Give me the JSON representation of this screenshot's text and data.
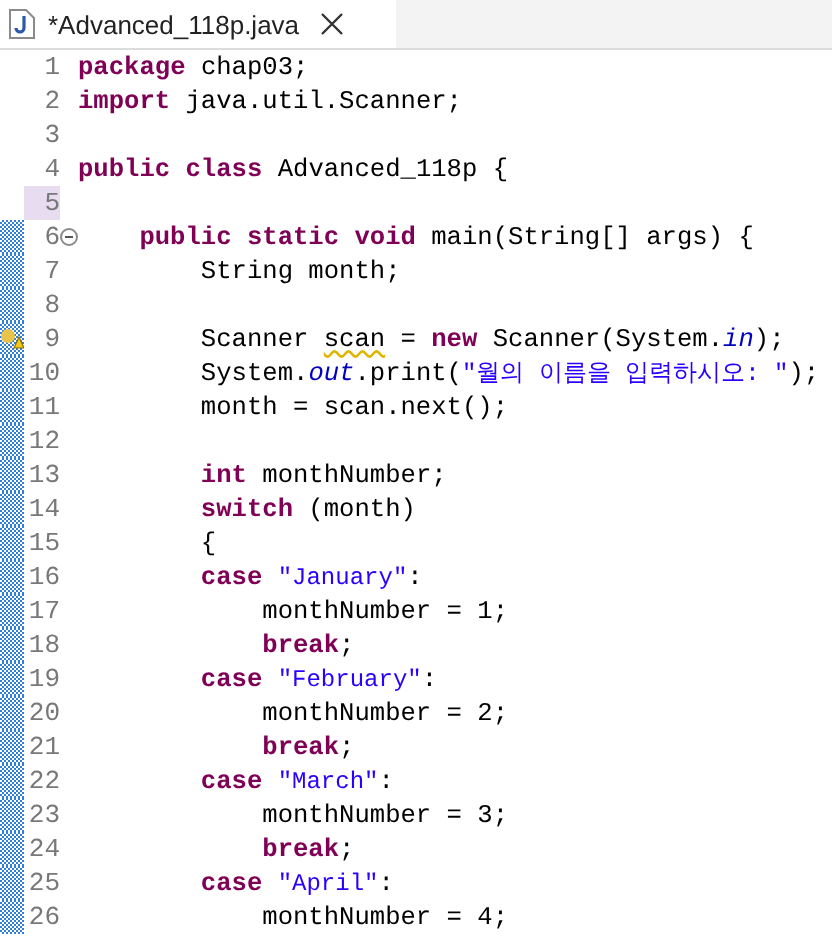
{
  "tab": {
    "title": "*Advanced_118p.java",
    "selected": true
  },
  "lines": [
    {
      "number": "1",
      "current": false,
      "in_range": false,
      "foldable": false,
      "warning": false,
      "tokens": [
        {
          "kind": "keyword",
          "text": "package"
        },
        {
          "kind": "plain",
          "text": " chap03;"
        }
      ]
    },
    {
      "number": "2",
      "current": false,
      "in_range": false,
      "foldable": false,
      "warning": false,
      "tokens": [
        {
          "kind": "keyword",
          "text": "import"
        },
        {
          "kind": "plain",
          "text": " java.util.Scanner;"
        }
      ]
    },
    {
      "number": "3",
      "current": false,
      "in_range": false,
      "foldable": false,
      "warning": false
    },
    {
      "number": "4",
      "current": false,
      "in_range": false,
      "foldable": false,
      "warning": false,
      "tokens": [
        {
          "kind": "keyword",
          "text": "public class"
        },
        {
          "kind": "plain",
          "text": " Advanced_118p {"
        }
      ],
      "children": [
        {
          "number": "5",
          "current": true,
          "in_range": false,
          "foldable": false,
          "warning": false
        },
        {
          "number": "6",
          "current": false,
          "in_range": true,
          "foldable": true,
          "warning": false,
          "tokens": [
            {
              "kind": "keyword",
              "text": "public static void"
            },
            {
              "kind": "plain",
              "text": " main(String[] args) {"
            }
          ],
          "children": [
            {
              "number": "7",
              "current": false,
              "in_range": true,
              "foldable": false,
              "warning": false,
              "tokens": [
                {
                  "kind": "plain",
                  "text": "String month;"
                }
              ]
            },
            {
              "number": "8",
              "current": false,
              "in_range": true,
              "foldable": false,
              "warning": false
            },
            {
              "number": "9",
              "current": false,
              "in_range": true,
              "foldable": false,
              "warning": true,
              "tokens": [
                {
                  "kind": "plain",
                  "text": "Scanner "
                },
                {
                  "kind": "warned",
                  "text": "scan"
                },
                {
                  "kind": "plain",
                  "text": " = "
                },
                {
                  "kind": "keyword",
                  "text": "new"
                },
                {
                  "kind": "plain",
                  "text": " Scanner(System."
                },
                {
                  "kind": "field",
                  "text": "in"
                },
                {
                  "kind": "plain",
                  "text": ");"
                }
              ]
            },
            {
              "number": "10",
              "current": false,
              "in_range": true,
              "foldable": false,
              "warning": false,
              "tokens": [
                {
                  "kind": "plain",
                  "text": "System."
                },
                {
                  "kind": "field",
                  "text": "out"
                },
                {
                  "kind": "plain",
                  "text": ".print("
                },
                {
                  "kind": "string",
                  "text": "\"월의 이름을 입력하시오: \""
                },
                {
                  "kind": "plain",
                  "text": ");"
                }
              ]
            },
            {
              "number": "11",
              "current": false,
              "in_range": true,
              "foldable": false,
              "warning": false,
              "tokens": [
                {
                  "kind": "plain",
                  "text": "month = scan.next();"
                }
              ]
            },
            {
              "number": "12",
              "current": false,
              "in_range": true,
              "foldable": false,
              "warning": false
            },
            {
              "number": "13",
              "current": false,
              "in_range": true,
              "foldable": false,
              "warning": false,
              "tokens": [
                {
                  "kind": "keyword",
                  "text": "int"
                },
                {
                  "kind": "plain",
                  "text": " monthNumber;"
                }
              ]
            },
            {
              "number": "14",
              "current": false,
              "in_range": true,
              "foldable": false,
              "warning": false,
              "tokens": [
                {
                  "kind": "keyword",
                  "text": "switch"
                },
                {
                  "kind": "plain",
                  "text": " (month)"
                }
              ]
            },
            {
              "number": "15",
              "current": false,
              "in_range": true,
              "foldable": false,
              "warning": false,
              "tokens": [
                {
                  "kind": "plain",
                  "text": "{"
                }
              ]
            },
            {
              "number": "16",
              "current": false,
              "in_range": true,
              "foldable": false,
              "warning": false,
              "tokens": [
                {
                  "kind": "keyword",
                  "text": "case "
                },
                {
                  "kind": "string",
                  "text": "\"January\""
                },
                {
                  "kind": "plain",
                  "text": ":"
                }
              ],
              "children": [
                {
                  "number": "17",
                  "current": false,
                  "in_range": true,
                  "foldable": false,
                  "warning": false,
                  "tokens": [
                    {
                      "kind": "plain",
                      "text": "monthNumber = 1;"
                    }
                  ]
                },
                {
                  "number": "18",
                  "current": false,
                  "in_range": true,
                  "foldable": false,
                  "warning": false,
                  "tokens": [
                    {
                      "kind": "keyword",
                      "text": "break"
                    },
                    {
                      "kind": "plain",
                      "text": ";"
                    }
                  ]
                }
              ]
            },
            {
              "number": "19",
              "current": false,
              "in_range": true,
              "foldable": false,
              "warning": false,
              "tokens": [
                {
                  "kind": "keyword",
                  "text": "case "
                },
                {
                  "kind": "string",
                  "text": "\"February\""
                },
                {
                  "kind": "plain",
                  "text": ":"
                }
              ],
              "children": [
                {
                  "number": "20",
                  "current": false,
                  "in_range": true,
                  "foldable": false,
                  "warning": false,
                  "tokens": [
                    {
                      "kind": "plain",
                      "text": "monthNumber = 2;"
                    }
                  ]
                },
                {
                  "number": "21",
                  "current": false,
                  "in_range": true,
                  "foldable": false,
                  "warning": false,
                  "tokens": [
                    {
                      "kind": "keyword",
                      "text": "break"
                    },
                    {
                      "kind": "plain",
                      "text": ";"
                    }
                  ]
                }
              ]
            },
            {
              "number": "22",
              "current": false,
              "in_range": true,
              "foldable": false,
              "warning": false,
              "tokens": [
                {
                  "kind": "keyword",
                  "text": "case "
                },
                {
                  "kind": "string",
                  "text": "\"March\""
                },
                {
                  "kind": "plain",
                  "text": ":"
                }
              ],
              "children": [
                {
                  "number": "23",
                  "current": false,
                  "in_range": true,
                  "foldable": false,
                  "warning": false,
                  "tokens": [
                    {
                      "kind": "plain",
                      "text": "monthNumber = 3;"
                    }
                  ]
                },
                {
                  "number": "24",
                  "current": false,
                  "in_range": true,
                  "foldable": false,
                  "warning": false,
                  "tokens": [
                    {
                      "kind": "keyword",
                      "text": "break"
                    },
                    {
                      "kind": "plain",
                      "text": ";"
                    }
                  ]
                }
              ]
            },
            {
              "number": "25",
              "current": false,
              "in_range": true,
              "foldable": false,
              "warning": false,
              "tokens": [
                {
                  "kind": "keyword",
                  "text": "case "
                },
                {
                  "kind": "string",
                  "text": "\"April\""
                },
                {
                  "kind": "plain",
                  "text": ":"
                }
              ],
              "children": [
                {
                  "number": "26",
                  "current": false,
                  "in_range": true,
                  "foldable": false,
                  "warning": false,
                  "tokens": [
                    {
                      "kind": "plain",
                      "text": "monthNumber = 4;"
                    }
                  ]
                }
              ]
            }
          ]
        }
      ]
    }
  ]
}
